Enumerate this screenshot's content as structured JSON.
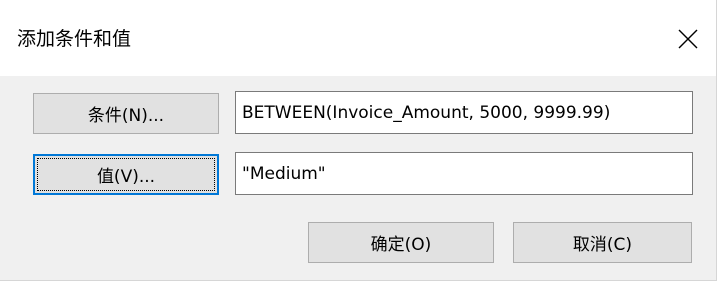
{
  "dialog": {
    "title": "添加条件和值",
    "close_icon": "close-icon"
  },
  "condition": {
    "button_label": "条件(N)...",
    "value": "BETWEEN(Invoice_Amount, 5000, 9999.99)"
  },
  "value": {
    "button_label": "值(V)...",
    "value": "\"Medium\""
  },
  "footer": {
    "ok_label": "确定(O)",
    "cancel_label": "取消(C)"
  },
  "colors": {
    "focus_border": "#0078d7",
    "button_face": "#e1e1e1",
    "dialog_bg": "#f0f0f0"
  }
}
